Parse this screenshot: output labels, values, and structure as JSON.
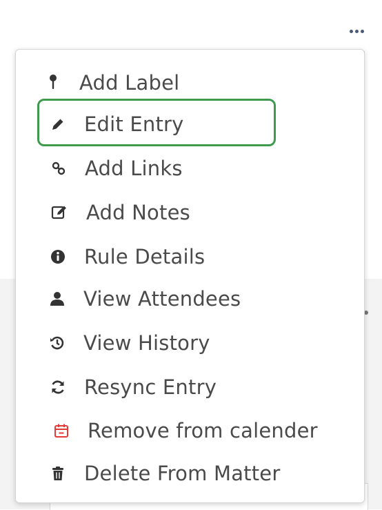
{
  "menu": {
    "more_label": "More actions",
    "items": [
      {
        "label": "Add Label",
        "icon": "pin-icon"
      },
      {
        "label": "Edit Entry",
        "icon": "pencil-icon"
      },
      {
        "label": "Add Links",
        "icon": "link-icon"
      },
      {
        "label": "Add Notes",
        "icon": "edit-note-icon"
      },
      {
        "label": "Rule Details",
        "icon": "info-icon"
      },
      {
        "label": "View Attendees",
        "icon": "user-icon"
      },
      {
        "label": "View History",
        "icon": "history-icon"
      },
      {
        "label": "Resync Entry",
        "icon": "sync-icon"
      },
      {
        "label": "Remove from calender",
        "icon": "calendar-remove-icon"
      },
      {
        "label": "Delete From Matter",
        "icon": "trash-icon"
      }
    ],
    "highlighted_item": "Edit Entry"
  },
  "colors": {
    "highlight": "#3e9a4d",
    "icon": "#333333",
    "remove_icon": "#e53935",
    "text": "#4a4a4a",
    "accent": "#2f77c9"
  }
}
